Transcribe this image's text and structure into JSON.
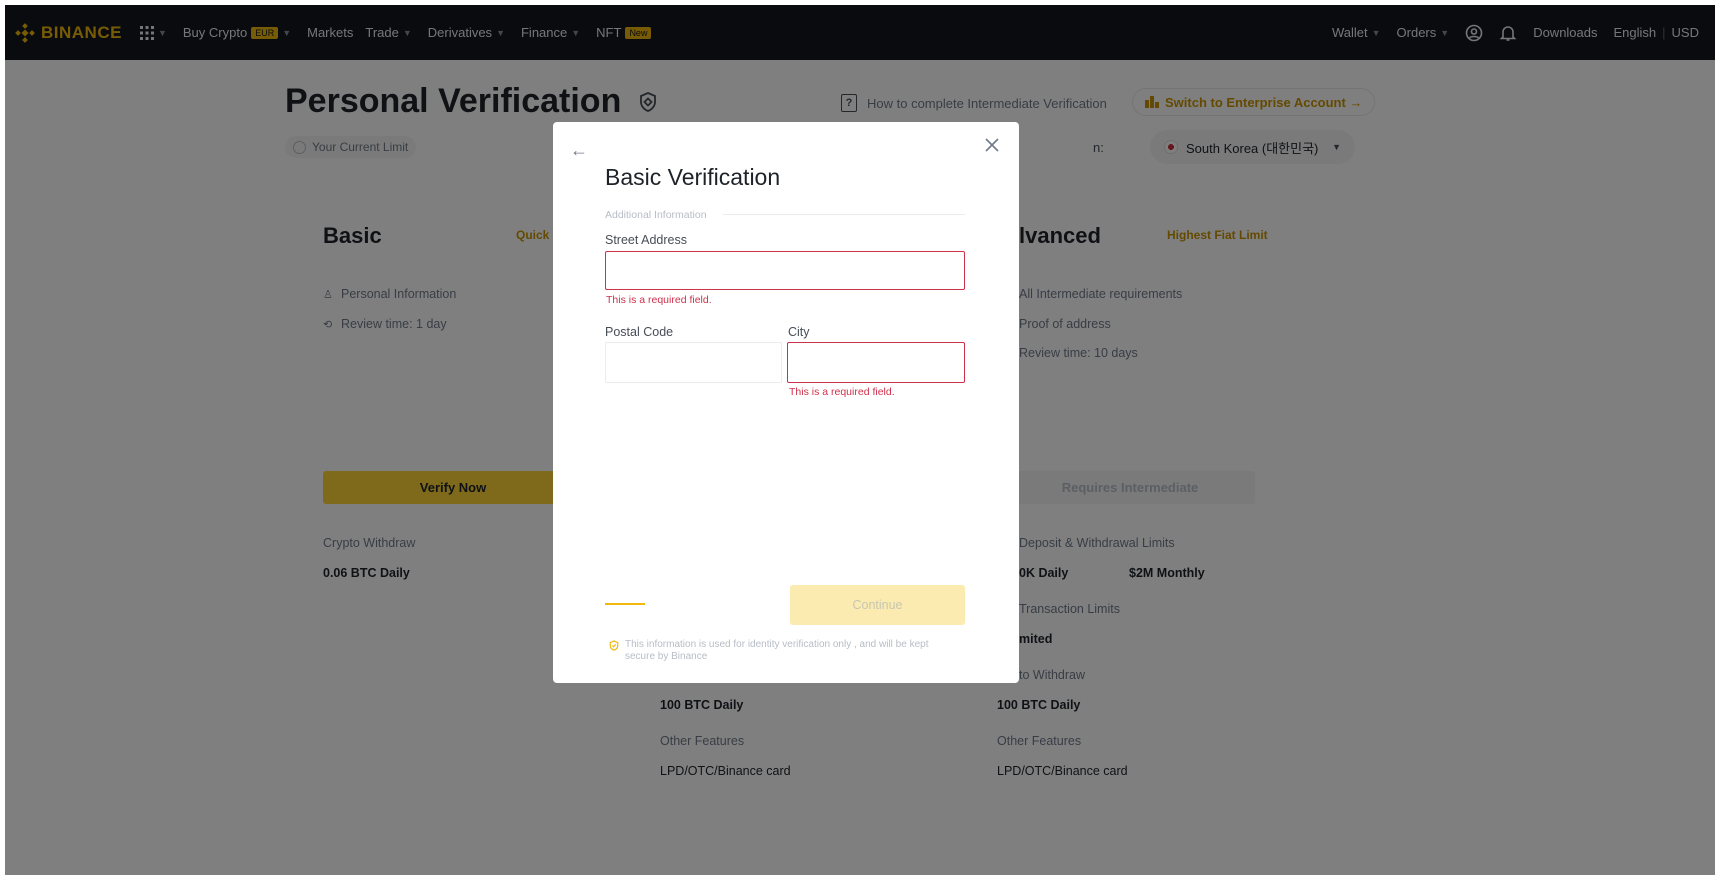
{
  "navbar": {
    "logo_text": "BINANCE",
    "items": [
      {
        "label": "Buy Crypto",
        "badge": "EUR",
        "has_caret": true
      },
      {
        "label": "Markets",
        "has_caret": false
      },
      {
        "label": "Trade",
        "has_caret": true
      },
      {
        "label": "Derivatives",
        "has_caret": true
      },
      {
        "label": "Finance",
        "has_caret": true
      },
      {
        "label": "NFT",
        "badge": "New",
        "has_caret": false
      }
    ],
    "right": {
      "wallet": "Wallet",
      "orders": "Orders",
      "downloads": "Downloads",
      "language": "English",
      "separator": "|",
      "currency": "USD"
    }
  },
  "page": {
    "title": "Personal Verification",
    "how_to_link": "How to complete Intermediate Verification",
    "enterprise_button": "Switch to Enterprise Account →",
    "current_limit": "Your Current Limit",
    "region_label": "n:",
    "region_value": "South Korea (대한민국)",
    "basic": {
      "title": "Basic",
      "tag": "Quick &",
      "requirements": [
        "Personal Information",
        "Review time: 1 day"
      ],
      "button": "Verify Now",
      "limit_label": "Crypto Withdraw",
      "limit_value": "0.06 BTC Daily"
    },
    "intermediate": {
      "crypto_value": "100 BTC Daily",
      "other_label": "Other Features",
      "other_value": "LPD/OTC/Binance card"
    },
    "advanced": {
      "title": "lvanced",
      "tag": "Highest Fiat Limit",
      "requirements": [
        "All Intermediate requirements",
        "Proof of address",
        "Review time: 10 days"
      ],
      "button": "Requires Intermediate",
      "fiat_label": "Deposit & Withdrawal Limits",
      "fiat_daily": "0K Daily",
      "fiat_monthly": "$2M Monthly",
      "p2p_label": "Transaction Limits",
      "p2p_value": "mited",
      "crypto_label": "to Withdraw",
      "crypto_value": "100 BTC Daily",
      "other_label": "Other Features",
      "other_value": "LPD/OTC/Binance card"
    }
  },
  "modal": {
    "title": "Basic Verification",
    "section": "Additional Information",
    "street_label": "Street Address",
    "street_value": "",
    "street_error": "This is a required field.",
    "postal_label": "Postal Code",
    "postal_value": "",
    "city_label": "City",
    "city_value": "",
    "city_error": "This is a required field.",
    "continue_button": "Continue",
    "secure_note": "This information is used for identity verification only , and will be kept secure by Binance"
  },
  "colors": {
    "brand": "#f0b90b",
    "error": "#cf304a",
    "navbar_bg": "#12161c"
  }
}
